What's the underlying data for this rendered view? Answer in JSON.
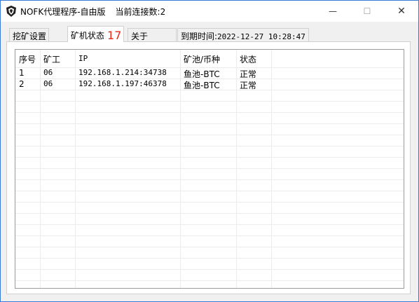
{
  "window": {
    "title": "NOFK代理程序-自由版",
    "connections": "当前连接数:2",
    "icon": "miner-logo-icon",
    "controls": {
      "minimize": "—",
      "maximize": "☐",
      "close": "✕"
    }
  },
  "tabs": [
    {
      "label": "挖矿设置",
      "active": false
    },
    {
      "label": "矿机状态",
      "count": "17",
      "active": true
    },
    {
      "label": "关于",
      "active": false
    }
  ],
  "expiry": {
    "label": "到期时间:",
    "value": "2022-12-27 10:28:47"
  },
  "table": {
    "columns": [
      "序号",
      "矿工",
      "IP",
      "矿池/币种",
      "状态"
    ],
    "rows": [
      [
        "1",
        "06",
        "192.168.1.214:34738",
        "鱼池-BTC",
        "正常"
      ],
      [
        "2",
        "06",
        "192.168.1.197:46378",
        "鱼池-BTC",
        "正常"
      ]
    ]
  },
  "colors": {
    "accent": "#3a7bd5",
    "count": "#e8271c"
  }
}
